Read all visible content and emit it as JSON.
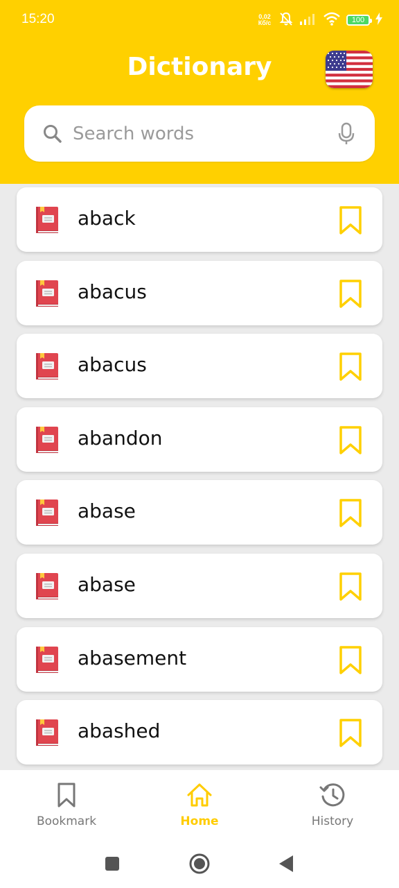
{
  "status_bar": {
    "time": "15:20",
    "speed_top": "0,02",
    "speed_bottom": "Кб/с",
    "battery": "100"
  },
  "header": {
    "title": "Dictionary",
    "flag_icon": "us-flag-icon"
  },
  "search": {
    "placeholder": "Search words",
    "value": ""
  },
  "words": [
    {
      "word": "aback"
    },
    {
      "word": "abacus"
    },
    {
      "word": "abacus"
    },
    {
      "word": "abandon"
    },
    {
      "word": "abase"
    },
    {
      "word": "abase"
    },
    {
      "word": "abasement"
    },
    {
      "word": "abashed"
    }
  ],
  "bottom_nav": {
    "bookmark": "Bookmark",
    "home": "Home",
    "history": "History",
    "active": "home"
  },
  "colors": {
    "accent": "#FFD000",
    "book": "#E0454F",
    "bookmark_outline": "#FFD000",
    "nav_inactive": "#777777"
  }
}
